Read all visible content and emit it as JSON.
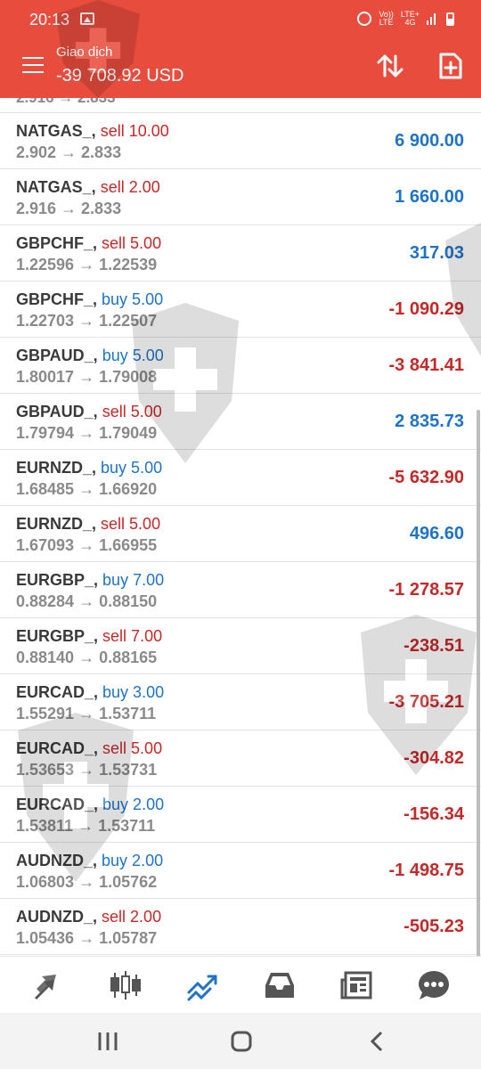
{
  "status_bar": {
    "time": "20:13",
    "network_label": "Vo)) LTE",
    "lte_label": "LTE+ 4G",
    "icons": [
      "image-icon",
      "alarm-icon",
      "volte-icon",
      "lte-icon",
      "signal-icon",
      "battery-icon"
    ]
  },
  "header": {
    "label": "Giao dịch",
    "balance": "-39 708.92 USD",
    "icons": [
      "menu-icon",
      "sort-icon",
      "add-document-icon"
    ]
  },
  "partial_row": {
    "prices": "2.916 → 2.833"
  },
  "trades": [
    {
      "symbol": "NATGAS_,",
      "direction": "sell",
      "volume": "sell 10.00",
      "prices": "2.902 → 2.833",
      "profit": "6 900.00",
      "sign": "pos"
    },
    {
      "symbol": "NATGAS_,",
      "direction": "sell",
      "volume": "sell 2.00",
      "prices": "2.916 → 2.833",
      "profit": "1 660.00",
      "sign": "pos"
    },
    {
      "symbol": "GBPCHF_,",
      "direction": "sell",
      "volume": "sell 5.00",
      "prices": "1.22596 → 1.22539",
      "profit": "317.03",
      "sign": "pos"
    },
    {
      "symbol": "GBPCHF_,",
      "direction": "buy",
      "volume": "buy 5.00",
      "prices": "1.22703 → 1.22507",
      "profit": "-1 090.29",
      "sign": "neg"
    },
    {
      "symbol": "GBPAUD_,",
      "direction": "buy",
      "volume": "buy 5.00",
      "prices": "1.80017 → 1.79008",
      "profit": "-3 841.41",
      "sign": "neg"
    },
    {
      "symbol": "GBPAUD_,",
      "direction": "sell",
      "volume": "sell 5.00",
      "prices": "1.79794 → 1.79049",
      "profit": "2 835.73",
      "sign": "pos"
    },
    {
      "symbol": "EURNZD_,",
      "direction": "buy",
      "volume": "buy 5.00",
      "prices": "1.68485 → 1.66920",
      "profit": "-5 632.90",
      "sign": "neg"
    },
    {
      "symbol": "EURNZD_,",
      "direction": "sell",
      "volume": "sell 5.00",
      "prices": "1.67093 → 1.66955",
      "profit": "496.60",
      "sign": "pos"
    },
    {
      "symbol": "EURGBP_,",
      "direction": "buy",
      "volume": "buy 7.00",
      "prices": "0.88284 → 0.88150",
      "profit": "-1 278.57",
      "sign": "neg"
    },
    {
      "symbol": "EURGBP_,",
      "direction": "sell",
      "volume": "sell 7.00",
      "prices": "0.88140 → 0.88165",
      "profit": "-238.51",
      "sign": "neg"
    },
    {
      "symbol": "EURCAD_,",
      "direction": "buy",
      "volume": "buy 3.00",
      "prices": "1.55291 → 1.53711",
      "profit": "-3 705.21",
      "sign": "neg"
    },
    {
      "symbol": "EURCAD_,",
      "direction": "sell",
      "volume": "sell 5.00",
      "prices": "1.53653 → 1.53731",
      "profit": "-304.82",
      "sign": "neg"
    },
    {
      "symbol": "EURCAD_,",
      "direction": "buy",
      "volume": "buy 2.00",
      "prices": "1.53811 → 1.53711",
      "profit": "-156.34",
      "sign": "neg"
    },
    {
      "symbol": "AUDNZD_,",
      "direction": "buy",
      "volume": "buy 2.00",
      "prices": "1.06803 → 1.05762",
      "profit": "-1 498.75",
      "sign": "neg"
    },
    {
      "symbol": "AUDNZD_,",
      "direction": "sell",
      "volume": "sell 2.00",
      "prices": "1.05436 → 1.05787",
      "profit": "-505.23",
      "sign": "neg"
    }
  ],
  "colors": {
    "header_bg": "#e74c3c",
    "sell": "#c62828",
    "buy": "#1e73c8",
    "profit_positive": "#1e73c8",
    "profit_negative": "#c62828",
    "tab_icon": "#555555",
    "tab_icon_active": "#1e73c8"
  },
  "tabbar": {
    "tabs": [
      {
        "icon": "quotes-arrows-icon",
        "active": false
      },
      {
        "icon": "candlestick-chart-icon",
        "active": false
      },
      {
        "icon": "trade-icon",
        "active": true
      },
      {
        "icon": "history-inbox-icon",
        "active": false
      },
      {
        "icon": "news-icon",
        "active": false
      },
      {
        "icon": "chat-icon",
        "active": false
      }
    ]
  },
  "navbar": {
    "icons": [
      "recent-apps-icon",
      "home-icon",
      "back-icon"
    ]
  }
}
